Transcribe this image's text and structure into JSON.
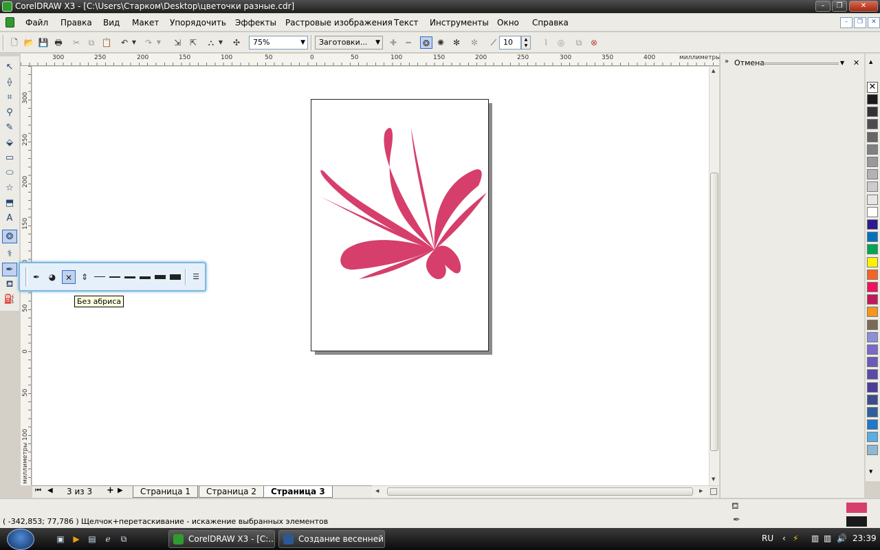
{
  "window": {
    "title": "CorelDRAW X3 - [C:\\Users\\Старком\\Desktop\\цветочки разные.cdr]",
    "controls": {
      "minimize": "–",
      "maximize": "❐",
      "close": "✕"
    }
  },
  "menu": {
    "items": [
      "Файл",
      "Правка",
      "Вид",
      "Макет",
      "Упорядочить",
      "Эффекты",
      "Растровые изображения",
      "Текст",
      "Инструменты",
      "Окно",
      "Справка"
    ],
    "mdi_controls": {
      "minimize": "–",
      "restore": "❐",
      "close": "✕"
    }
  },
  "toolbar": {
    "zoom_value": "75%",
    "presets_value": "Заготовки...",
    "dropdown_arrow": "▼",
    "spin_value": "10",
    "spin_up": "▲",
    "spin_down": "▼"
  },
  "rulers": {
    "unit_label": "миллиметры",
    "h_ticks": [
      "300",
      "250",
      "200",
      "150",
      "100",
      "50",
      "0",
      "50",
      "100",
      "150",
      "200",
      "250",
      "300",
      "350",
      "400"
    ],
    "v_ticks": [
      "300",
      "250",
      "200",
      "150",
      "100",
      "50",
      "0",
      "50",
      "100"
    ]
  },
  "page_tabs": {
    "counter": "3 из 3",
    "first": "⏮",
    "prev": "◀",
    "add": "+",
    "next": "▶",
    "tabs": [
      "Страница 1",
      "Страница 2",
      "Страница 3"
    ],
    "active_index": 2
  },
  "docker": {
    "title": "Отмена",
    "menu_arrow": "▼",
    "close": "✕",
    "expand": "»"
  },
  "flyout": {
    "tooltip": "Без абриса"
  },
  "palette": {
    "colors": [
      "#1a1a1a",
      "#333333",
      "#4d4d4d",
      "#666666",
      "#808080",
      "#999999",
      "#b3b3b3",
      "#cccccc",
      "#e6e6e6",
      "#ffffff",
      "#2e1a8c",
      "#0072bc",
      "#00a651",
      "#fff200",
      "#f26522",
      "#ed145b",
      "#c2185b",
      "#f7941d",
      "#7a6a55",
      "#8c8fd6",
      "#7b68c8",
      "#6a5bb8",
      "#5b4aa8",
      "#4d3c98",
      "#3c4c8c",
      "#2f5f9c",
      "#1f78c8",
      "#5aaee0",
      "#8fb8d0"
    ]
  },
  "status": {
    "coords": "( -342,853; 77,786 )",
    "message": "Щелчок+перетаскивание - искажение выбранных элементов",
    "fill_color": "#d63f6b",
    "outline_color": "#1a1a1a"
  },
  "taskbar": {
    "tasks": [
      "CorelDRAW X3 - [C:...",
      "Создание весенней..."
    ],
    "lang": "RU",
    "time": "23:39",
    "tray_chevron": "‹"
  },
  "colors": {
    "flower": "#d63f6b",
    "selection": "#316ac5"
  }
}
